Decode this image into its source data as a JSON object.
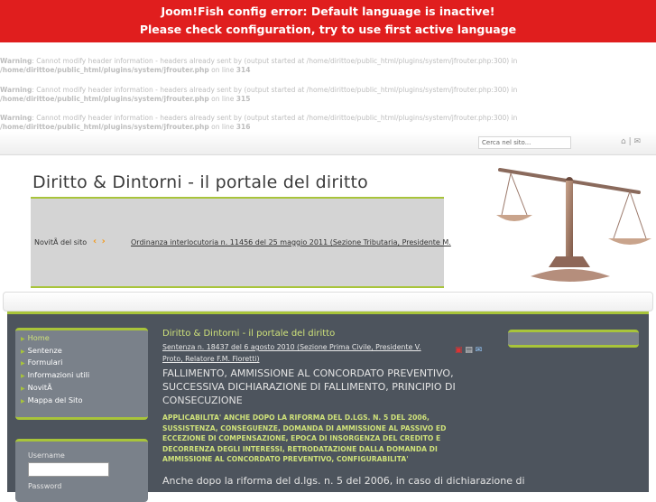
{
  "error": {
    "line1": "Joom!Fish config error: Default language is inactive!",
    "line2": "Please check configuration, try to use first active language"
  },
  "warnings": [
    {
      "label": "Warning",
      "text": ": Cannot modify header information - headers already sent by (output started at /home/dirittoe/public_html/plugins/system/jfrouter.php:300) in",
      "file": "/home/dirittoe/public_html/plugins/system/jfrouter.php",
      "line_text": " on line ",
      "line": "314"
    },
    {
      "label": "Warning",
      "text": ": Cannot modify header information - headers already sent by (output started at /home/dirittoe/public_html/plugins/system/jfrouter.php:300) in",
      "file": "/home/dirittoe/public_html/plugins/system/jfrouter.php",
      "line_text": " on line ",
      "line": "315"
    },
    {
      "label": "Warning",
      "text": ": Cannot modify header information - headers already sent by (output started at /home/dirittoe/public_html/plugins/system/jfrouter.php:300) in",
      "file": "/home/dirittoe/public_html/plugins/system/jfrouter.php",
      "line_text": " on line ",
      "line": "316"
    }
  ],
  "search": {
    "placeholder": "Cerca nel sito..."
  },
  "site_title": "Diritto & Dintorni - il portale del diritto",
  "news": {
    "label": "NovitÃ  del sito",
    "arrows": "‹ ›",
    "link": "Ordinanza interlocutoria n. 11456 del 25 maggio 2011 (Sezione Tributaria, Presidente M."
  },
  "menu": [
    "Home",
    "Sentenze",
    "Formulari",
    "Informazioni utili",
    "NovitÃ ",
    "Mappa del Sito"
  ],
  "login": {
    "username_label": "Username",
    "password_label": "Password"
  },
  "article": {
    "title": "Diritto & Dintorni - il portale del diritto",
    "subtitle": "Sentenza n. 18437 del 6 agosto 2010 (Sezione Prima Civile, Presidente V. Proto, Relatore F.M. Fioretti)",
    "heading": "FALLIMENTO, AMMISSIONE AL CONCORDATO PREVENTIVO, SUCCESSIVA DICHIARAZIONE DI FALLIMENTO, PRINCIPIO DI CONSECUZIONE",
    "summary": "APPLICABILITA' ANCHE DOPO LA RIFORMA DEL D.LGS. N. 5 DEL 2006, SUSSISTENZA, CONSEGUENZE, DOMANDA DI AMMISSIONE AL PASSIVO ED ECCEZIONE DI COMPENSAZIONE, EPOCA DI INSORGENZA DEL CREDITO E DECORRENZA DEGLI INTERESSI, RETRODATAZIONE DALLA DOMANDA DI AMMISSIONE AL CONCORDATO PREVENTIVO, CONFIGURABILITA'",
    "body": "Anche dopo la riforma del d.lgs. n. 5 del 2006, in caso di dichiarazione di"
  },
  "colors": {
    "accent": "#a8c43a",
    "error_bg": "#e01e1e",
    "main_bg": "#4d545d",
    "box_bg": "#7a818a"
  }
}
